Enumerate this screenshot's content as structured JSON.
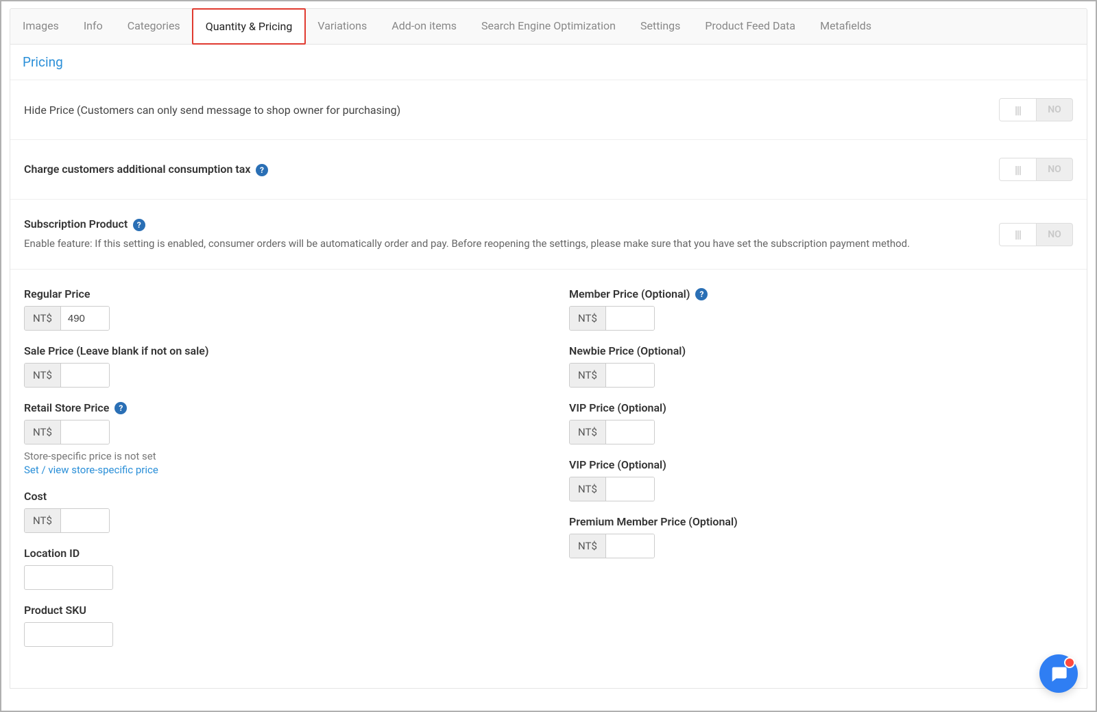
{
  "tabs": {
    "images": "Images",
    "info": "Info",
    "categories": "Categories",
    "quantity_pricing": "Quantity & Pricing",
    "variations": "Variations",
    "addon_items": "Add-on items",
    "seo": "Search Engine Optimization",
    "settings": "Settings",
    "product_feed": "Product Feed Data",
    "metafields": "Metafields"
  },
  "section": {
    "title": "Pricing"
  },
  "toggles": {
    "hide_price_label": "Hide Price (Customers can only send message to shop owner for purchasing)",
    "tax_label": "Charge customers additional consumption tax",
    "subscription_label": "Subscription Product",
    "subscription_sub": "Enable feature: If this setting is enabled, consumer orders will be automatically order and pay. Before reopening the settings, please make sure that you have set the subscription payment method.",
    "state_no": "NO"
  },
  "currency": "NT$",
  "left": {
    "regular_price_label": "Regular Price",
    "regular_price_value": "490",
    "sale_price_label": "Sale Price (Leave blank if not on sale)",
    "sale_price_value": "",
    "retail_price_label": "Retail Store Price",
    "retail_price_value": "",
    "retail_note": "Store-specific price is not set",
    "retail_link": "Set / view store-specific price",
    "cost_label": "Cost",
    "cost_value": "",
    "location_id_label": "Location ID",
    "location_id_value": "",
    "sku_label": "Product SKU",
    "sku_value": ""
  },
  "right": {
    "member_price_label": "Member Price (Optional)",
    "member_price_value": "",
    "newbie_price_label": "Newbie Price (Optional)",
    "newbie_price_value": "",
    "vip_price1_label": "VIP Price (Optional)",
    "vip_price1_value": "",
    "vip_price2_label": "VIP Price (Optional)",
    "vip_price2_value": "",
    "premium_price_label": "Premium Member Price (Optional)",
    "premium_price_value": ""
  },
  "help_icon_text": "?"
}
